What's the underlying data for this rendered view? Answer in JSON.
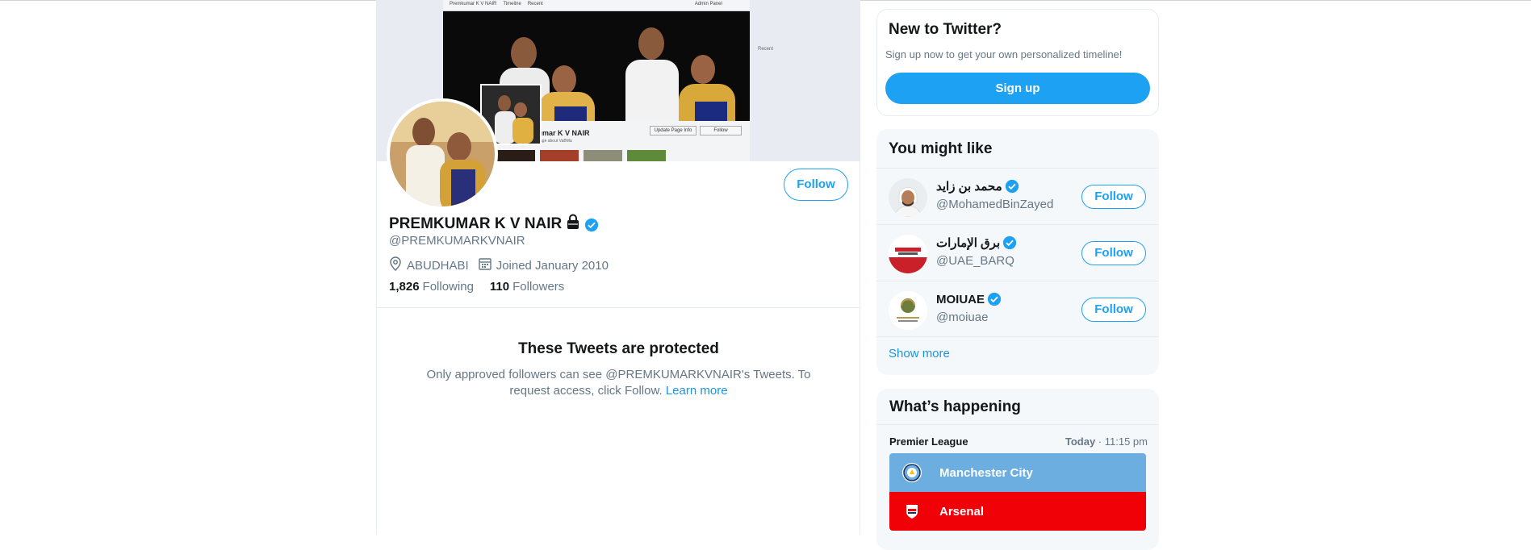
{
  "profile": {
    "name": "PREMKUMAR K V NAIR",
    "handle": "@PREMKUMARKVNAIR",
    "location": "ABUDHABI",
    "joined": "Joined January 2010",
    "following_count": "1,826",
    "following_label": "Following",
    "followers_count": "110",
    "followers_label": "Followers",
    "follow_label": "Follow"
  },
  "banner": {
    "topbar_name": "Premkumar K V NAIR",
    "topbar_timeline": "Timeline",
    "topbar_recent": "Recent",
    "topbar_admin": "Admin Panel",
    "page_name": "Premkumar K V NAIR",
    "page_sub": "Community Page about VaBMa",
    "update_btn": "Update Page Info",
    "follow_btn": "Follow",
    "side_recent": "Recent"
  },
  "protected": {
    "title": "These Tweets are protected",
    "body": "Only approved followers can see @PREMKUMARKVNAIR's Tweets. To request access, click Follow.",
    "learn_more": "Learn more"
  },
  "new_to_twitter": {
    "title": "New to Twitter?",
    "subtitle": "Sign up now to get your own personalized timeline!",
    "signup_label": "Sign up"
  },
  "you_might_like": {
    "title": "You might like",
    "items": [
      {
        "name": "محمد بن زايد",
        "handle": "@MohamedBinZayed",
        "follow": "Follow"
      },
      {
        "name": "برق الإمارات",
        "handle": "@UAE_BARQ",
        "follow": "Follow"
      },
      {
        "name": "MOIUAE",
        "handle": "@moiuae",
        "follow": "Follow"
      }
    ],
    "show_more": "Show more"
  },
  "whats_happening": {
    "title": "What’s happening",
    "league": "Premier League",
    "day": "Today",
    "time": "11:15 pm",
    "team1": "Manchester City",
    "team2": "Arsenal"
  },
  "colors": {
    "accent": "#1da1f2",
    "city": "#6caee0",
    "arsenal": "#ef0107"
  }
}
